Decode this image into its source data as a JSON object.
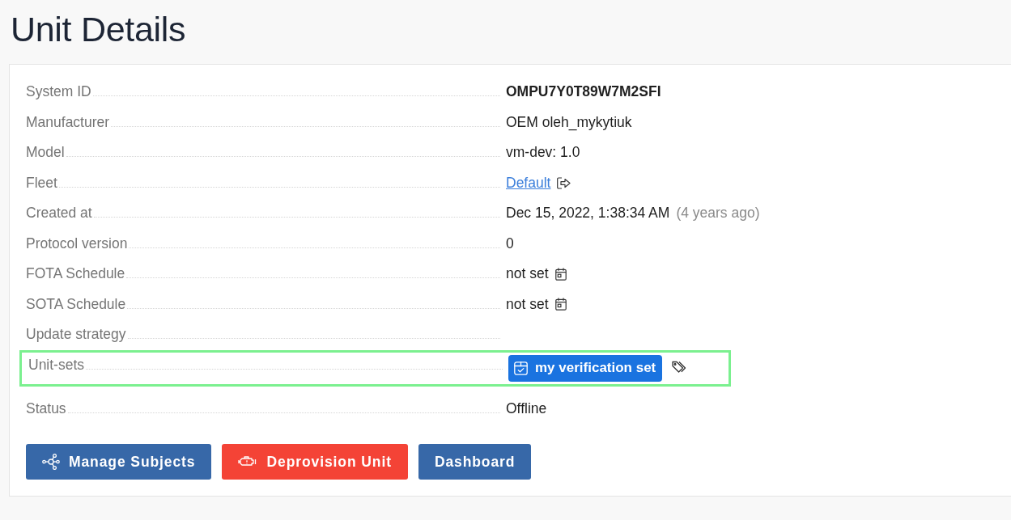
{
  "title": "Unit Details",
  "details": [
    {
      "kind": "text",
      "label": "System ID",
      "value": "OMPU7Y0T89W7M2SFI",
      "bold": true,
      "highlighted": false
    },
    {
      "kind": "text",
      "label": "Manufacturer",
      "value": "OEM oleh_mykytiuk",
      "highlighted": false
    },
    {
      "kind": "text",
      "label": "Model",
      "value": "vm-dev: 1.0",
      "highlighted": false
    },
    {
      "kind": "link",
      "label": "Fleet",
      "value": "Default",
      "highlighted": false
    },
    {
      "kind": "date",
      "label": "Created at",
      "value": "Dec 15, 2022, 1:38:34 AM",
      "note": "(4 years ago)",
      "highlighted": false
    },
    {
      "kind": "text",
      "label": "Protocol version",
      "value": "0",
      "highlighted": false
    },
    {
      "kind": "schedule",
      "label": "FOTA Schedule",
      "value": "not set",
      "highlighted": false
    },
    {
      "kind": "schedule",
      "label": "SOTA Schedule",
      "value": "not set",
      "highlighted": false
    },
    {
      "kind": "empty",
      "label": "Update strategy",
      "highlighted": false
    },
    {
      "kind": "tags",
      "label": "Unit-sets",
      "tags": [
        "my verification set"
      ],
      "highlighted": true
    },
    {
      "kind": "text",
      "label": "Status",
      "value": "Offline",
      "highlighted": false
    }
  ],
  "buttons": [
    {
      "kind": "subjects",
      "label": "Manage Subjects"
    },
    {
      "kind": "deprovision",
      "label": "Deprovision Unit"
    },
    {
      "kind": "dashboard",
      "label": "Dashboard"
    }
  ]
}
